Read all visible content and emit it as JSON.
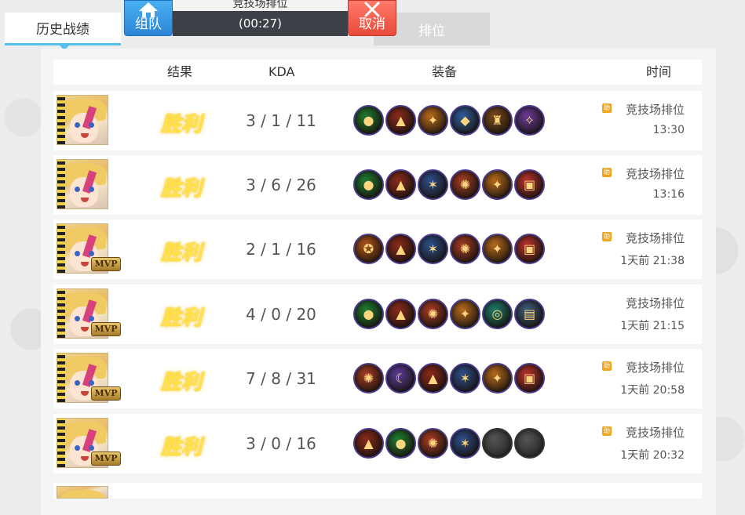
{
  "tabs": {
    "history": "历史战绩",
    "rank": "排位"
  },
  "match": {
    "team_label": "组队",
    "cancel_label": "取消",
    "mode_title": "竞技场排位",
    "timer": "(00:27)"
  },
  "columns": {
    "result": "结果",
    "kda": "KDA",
    "equipment": "装备",
    "time": "时间"
  },
  "matches": [
    {
      "result": "胜利",
      "kda": "3 / 1 / 11",
      "mvp": false,
      "mvp_label": "",
      "mode_badge": "助",
      "mode": "竞技场排位",
      "time": "13:30",
      "items": [
        {
          "icon": "green-orb",
          "color": "#1e7a2f",
          "glyph": "●"
        },
        {
          "icon": "red-boots",
          "color": "#8a2a1a",
          "glyph": "▲"
        },
        {
          "icon": "golden-relic",
          "color": "#b56a1c",
          "glyph": "✦"
        },
        {
          "icon": "blue-armor",
          "color": "#2f5d9a",
          "glyph": "◆"
        },
        {
          "icon": "bronze-helm",
          "color": "#7a4a1e",
          "glyph": "♜"
        },
        {
          "icon": "purple-staff",
          "color": "#6b3a9a",
          "glyph": "✧"
        }
      ]
    },
    {
      "result": "胜利",
      "kda": "3 / 6 / 26",
      "mvp": false,
      "mvp_label": "",
      "mode_badge": "助",
      "mode": "竞技场排位",
      "time": "13:16",
      "items": [
        {
          "icon": "green-orb",
          "color": "#1e7a2f",
          "glyph": "●"
        },
        {
          "icon": "red-boots",
          "color": "#8a2a1a",
          "glyph": "▲"
        },
        {
          "icon": "blue-crystal",
          "color": "#2c4e8a",
          "glyph": "✶"
        },
        {
          "icon": "red-gear",
          "color": "#a33b22",
          "glyph": "✺"
        },
        {
          "icon": "golden-relic",
          "color": "#b56a1c",
          "glyph": "✦"
        },
        {
          "icon": "red-scroll",
          "color": "#b8322c",
          "glyph": "▣"
        }
      ]
    },
    {
      "result": "胜利",
      "kda": "2 / 1 / 16",
      "mvp": true,
      "mvp_label": "MVP",
      "mode_badge": "助",
      "mode": "竞技场排位",
      "time": "1天前  21:38",
      "items": [
        {
          "icon": "orange-gauntlet",
          "color": "#b0541a",
          "glyph": "✪"
        },
        {
          "icon": "red-boots",
          "color": "#8a2a1a",
          "glyph": "▲"
        },
        {
          "icon": "blue-crystal",
          "color": "#2c4e8a",
          "glyph": "✶"
        },
        {
          "icon": "red-gear",
          "color": "#a33b22",
          "glyph": "✺"
        },
        {
          "icon": "golden-relic",
          "color": "#b56a1c",
          "glyph": "✦"
        },
        {
          "icon": "red-scroll",
          "color": "#b8322c",
          "glyph": "▣"
        }
      ]
    },
    {
      "result": "胜利",
      "kda": "4 / 0 / 20",
      "mvp": true,
      "mvp_label": "MVP",
      "mode_badge": "",
      "mode": "竞技场排位",
      "time": "1天前  21:15",
      "items": [
        {
          "icon": "green-orb",
          "color": "#1e7a2f",
          "glyph": "●"
        },
        {
          "icon": "red-boots",
          "color": "#8a2a1a",
          "glyph": "▲"
        },
        {
          "icon": "red-gear",
          "color": "#a33b22",
          "glyph": "✺"
        },
        {
          "icon": "golden-relic",
          "color": "#b56a1c",
          "glyph": "✦"
        },
        {
          "icon": "teal-ring",
          "color": "#1d7a6a",
          "glyph": "◎"
        },
        {
          "icon": "steel-tome",
          "color": "#3e5a78",
          "glyph": "▤"
        }
      ]
    },
    {
      "result": "胜利",
      "kda": "7 / 8 / 31",
      "mvp": true,
      "mvp_label": "MVP",
      "mode_badge": "助",
      "mode": "竞技场排位",
      "time": "1天前  20:58",
      "items": [
        {
          "icon": "red-gear",
          "color": "#a33b22",
          "glyph": "✺"
        },
        {
          "icon": "purple-horn",
          "color": "#5b3c9a",
          "glyph": "☾"
        },
        {
          "icon": "red-boots",
          "color": "#8a2a1a",
          "glyph": "▲"
        },
        {
          "icon": "blue-crystal",
          "color": "#2c4e8a",
          "glyph": "✶"
        },
        {
          "icon": "golden-relic",
          "color": "#b56a1c",
          "glyph": "✦"
        },
        {
          "icon": "red-scroll",
          "color": "#b8322c",
          "glyph": "▣"
        }
      ]
    },
    {
      "result": "胜利",
      "kda": "3 / 0 / 16",
      "mvp": true,
      "mvp_label": "MVP",
      "mode_badge": "助",
      "mode": "竞技场排位",
      "time": "1天前  20:32",
      "items": [
        {
          "icon": "red-boots",
          "color": "#8a2a1a",
          "glyph": "▲"
        },
        {
          "icon": "green-orb",
          "color": "#1e7a2f",
          "glyph": "●"
        },
        {
          "icon": "red-gear",
          "color": "#a33b22",
          "glyph": "✺"
        },
        {
          "icon": "blue-crystal",
          "color": "#2c4e8a",
          "glyph": "✶"
        },
        {
          "icon": "empty-slot",
          "color": "#2a2a2a",
          "glyph": ""
        },
        {
          "icon": "empty-slot",
          "color": "#2a2a2a",
          "glyph": ""
        }
      ]
    }
  ]
}
